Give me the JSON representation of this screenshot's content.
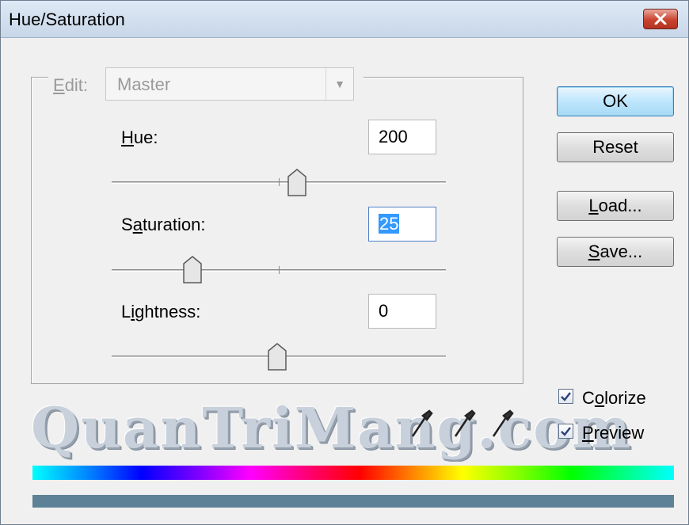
{
  "window": {
    "title": "Hue/Saturation"
  },
  "edit": {
    "label_prefix": "",
    "label_u": "E",
    "label_rest": "dit:",
    "value": "Master"
  },
  "hue": {
    "label_u": "H",
    "label_rest": "ue:",
    "value": "200",
    "level": 200,
    "min": -180,
    "max": 180
  },
  "saturation": {
    "label_pre": "S",
    "label_u": "a",
    "label_rest": "turation:",
    "value": "25",
    "level": 25,
    "min": -100,
    "max": 100
  },
  "lightness": {
    "label_pre": "L",
    "label_u": "i",
    "label_rest": "ghtness:",
    "value": "0",
    "level": 0,
    "min": -100,
    "max": 100
  },
  "buttons": {
    "ok": "OK",
    "reset": "Reset",
    "load_u": "L",
    "load_rest": "oad...",
    "save_u": "S",
    "save_rest": "ave..."
  },
  "options": {
    "colorize_pre": "C",
    "colorize_u": "o",
    "colorize_rest": "lorize",
    "colorize_checked": true,
    "preview_u": "P",
    "preview_rest": "review",
    "preview_checked": true
  },
  "watermark": "QuanTriMang.com",
  "icons": [
    "close-icon",
    "chevron-down-icon",
    "eyedropper-icon",
    "eyedropper-plus-icon",
    "eyedropper-minus-icon",
    "checkmark-icon"
  ]
}
